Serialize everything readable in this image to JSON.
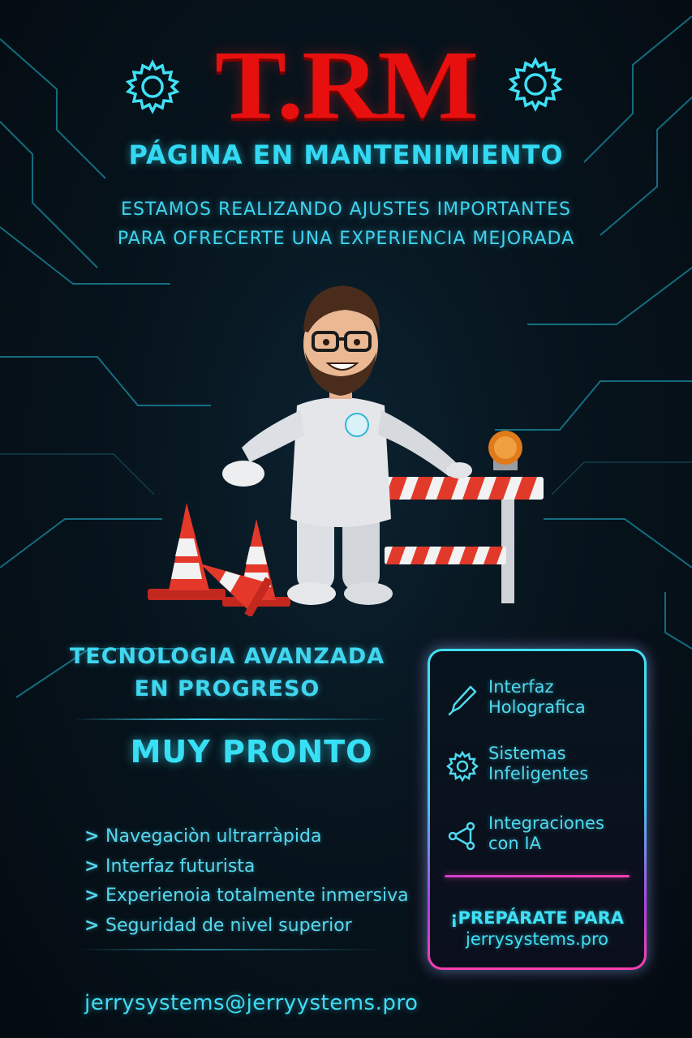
{
  "brand": {
    "logo_text": "T.RM"
  },
  "header": {
    "headline": "PÁGINA EN MANTENIMIENTO",
    "sub_line_1": "ESTAMOS REALIZANDO AJUSTES IMPORTANTES",
    "sub_line_2": "PARA OFRECERTE UNA EXPERIENCIA MEJORADA"
  },
  "left_column": {
    "tech_line_1": "TECNOLOGIA AVANZADA",
    "tech_line_2": "EN PROGRESO",
    "soon": "MUY PRONTO",
    "bullet_marker": ">",
    "bullets": [
      "Navegaciòn ultrarràpida",
      "Interfaz futurista",
      "Experienoia totalmente inmersiva",
      "Seguridad de nivel superior"
    ]
  },
  "features": [
    {
      "icon": "stylus-icon",
      "line_1": "Interfaz",
      "line_2": "Holografica"
    },
    {
      "icon": "gear-icon",
      "line_1": "Sistemas",
      "line_2": "Infeligentes"
    },
    {
      "icon": "network-nodes-icon",
      "line_1": "Integraciones",
      "line_2": "con IA"
    }
  ],
  "cta": {
    "line_1": "¡PREPÁRATE PARA",
    "line_2": "jerrysystems.pro"
  },
  "footer": {
    "email": "jerrysystems@jerryystems.pro"
  },
  "colors": {
    "background": "#06121a",
    "cyan_accent": "#3fd6f0",
    "brand_red": "#e8100e",
    "panel_pink": "#ff3fb0"
  }
}
